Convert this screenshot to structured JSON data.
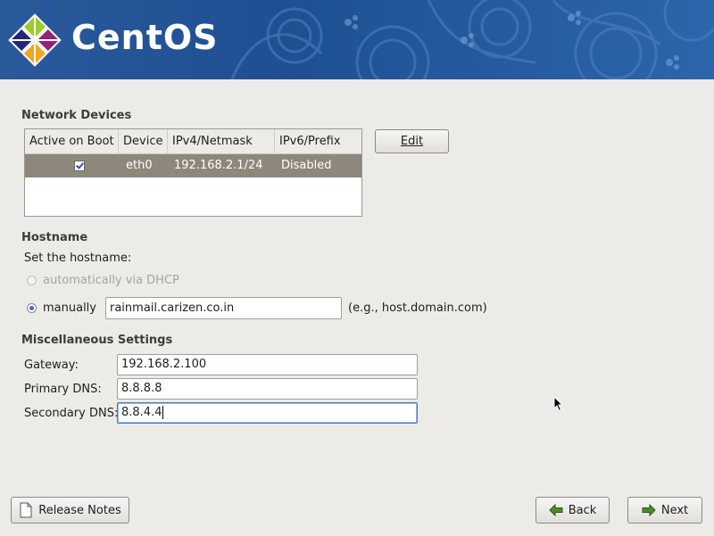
{
  "banner": {
    "brand": "CentOS"
  },
  "network_devices": {
    "title": "Network Devices",
    "columns": [
      "Active on Boot",
      "Device",
      "IPv4/Netmask",
      "IPv6/Prefix"
    ],
    "rows": [
      {
        "active": true,
        "device": "eth0",
        "ipv4": "192.168.2.1/24",
        "ipv6": "Disabled"
      }
    ],
    "edit_label": "Edit"
  },
  "hostname": {
    "title": "Hostname",
    "prompt": "Set the hostname:",
    "auto_label": "automatically via DHCP",
    "manual_label": "manually",
    "manual_value": "rainmail.carizen.co.in",
    "example": "(e.g., host.domain.com)"
  },
  "misc": {
    "title": "Miscellaneous Settings",
    "gateway_label": "Gateway:",
    "gateway_value": "192.168.2.100",
    "primary_dns_label": "Primary DNS:",
    "primary_dns_value": "8.8.8.8",
    "secondary_dns_label": "Secondary DNS:",
    "secondary_dns_value": "8.8.4.4"
  },
  "footer": {
    "release_notes_label": "Release Notes",
    "back_label": "Back",
    "next_label": "Next"
  },
  "colors": {
    "banner": "#2a5a9a",
    "selected_row": "#8e877c",
    "background": "#edebe7"
  }
}
